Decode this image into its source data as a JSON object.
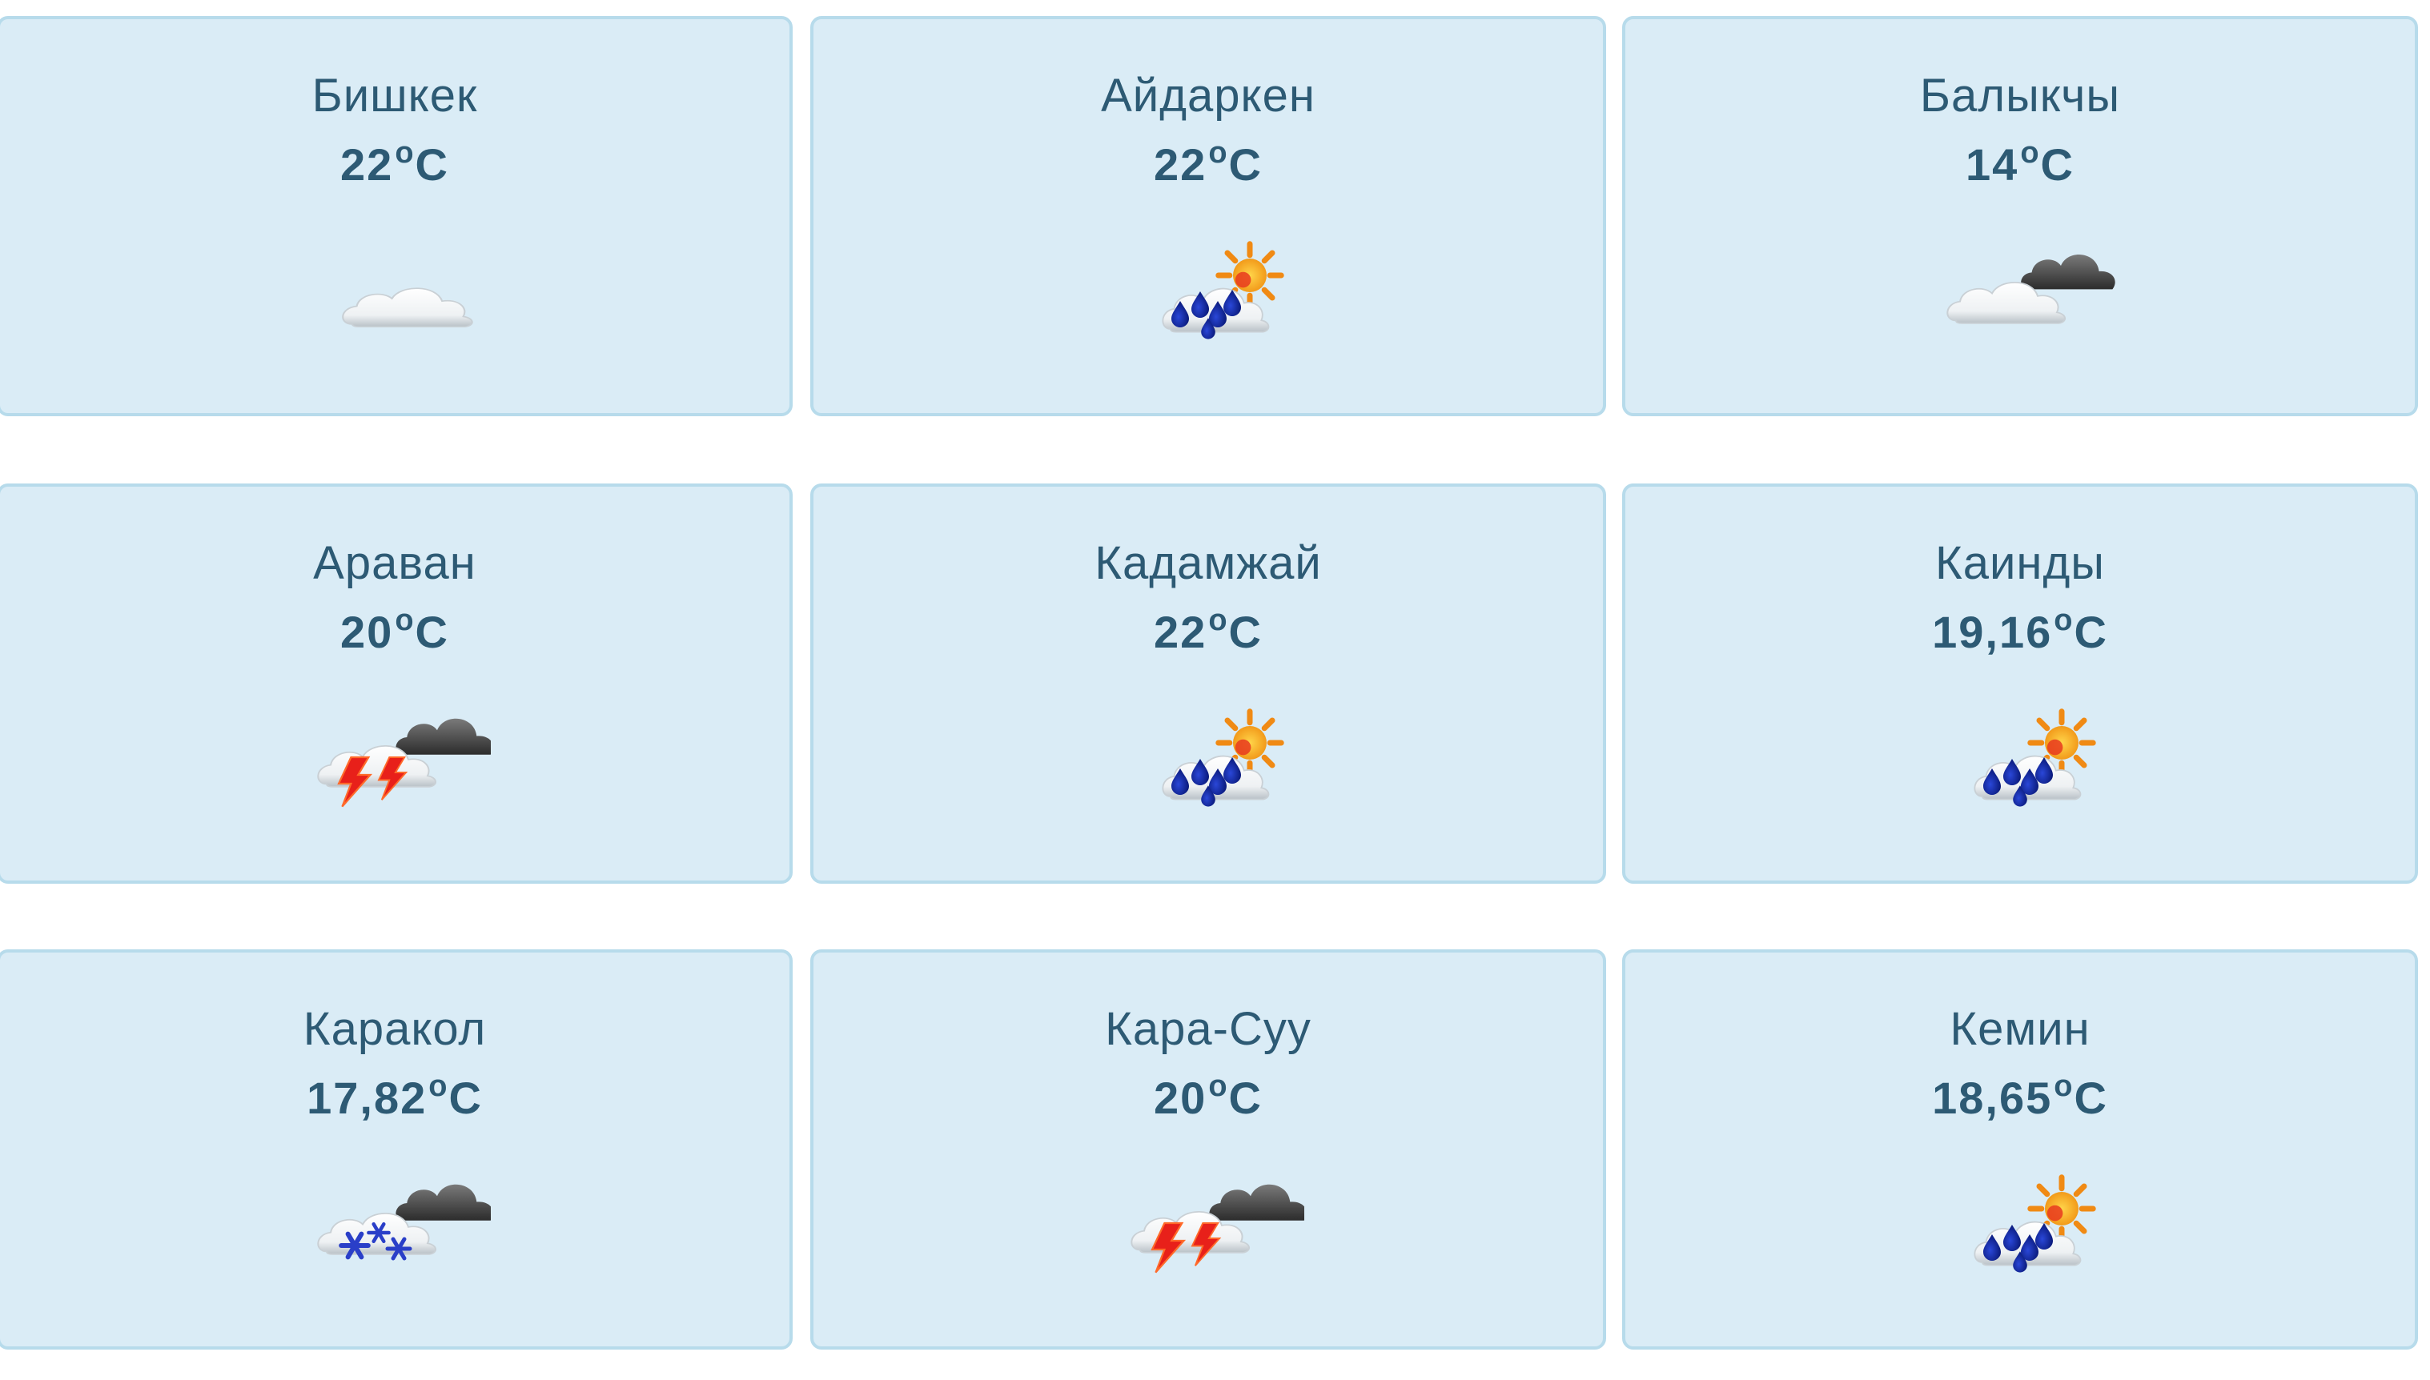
{
  "cards": [
    {
      "city": "Бишкек",
      "temp": "22",
      "unit": "C",
      "icon": "cloud-icon"
    },
    {
      "city": "Айдаркен",
      "temp": "22",
      "unit": "C",
      "icon": "sun-rain-icon"
    },
    {
      "city": "Балыкчы",
      "temp": "14",
      "unit": "C",
      "icon": "overcast-icon"
    },
    {
      "city": "Араван",
      "temp": "20",
      "unit": "C",
      "icon": "thunderstorm-icon"
    },
    {
      "city": "Кадамжай",
      "temp": "22",
      "unit": "C",
      "icon": "sun-rain-icon"
    },
    {
      "city": "Каинды",
      "temp": "19,16",
      "unit": "C",
      "icon": "sun-rain-icon"
    },
    {
      "city": "Каракол",
      "temp": "17,82",
      "unit": "C",
      "icon": "snow-icon"
    },
    {
      "city": "Кара-Суу",
      "temp": "20",
      "unit": "C",
      "icon": "thunderstorm-icon"
    },
    {
      "city": "Кемин",
      "temp": "18,65",
      "unit": "C",
      "icon": "sun-rain-icon"
    }
  ],
  "degree_symbol": "o",
  "colors": {
    "card_bg": "#daecf6",
    "card_border": "#b7dbeb",
    "text": "#2d5a74"
  }
}
